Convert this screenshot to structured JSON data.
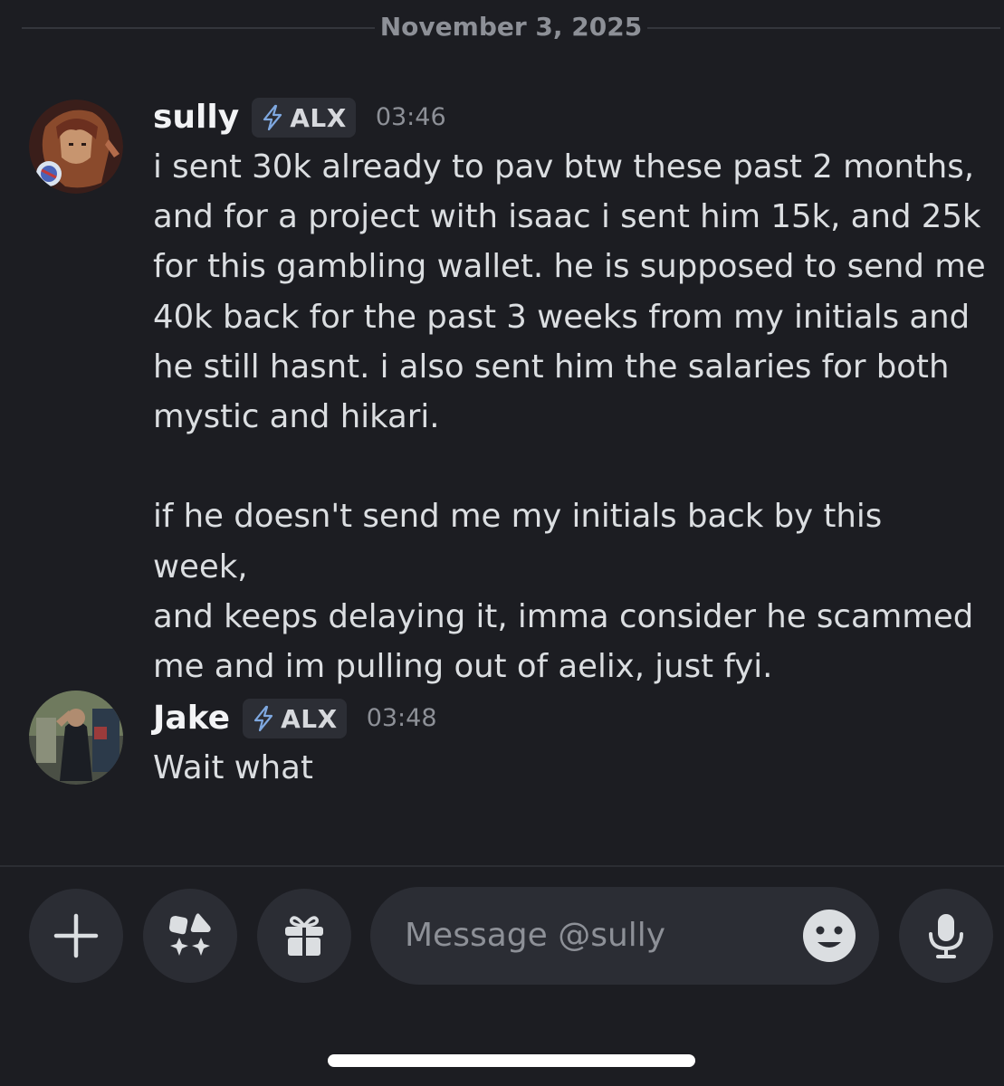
{
  "date_divider": "November 3, 2025",
  "messages": [
    {
      "username": "sully",
      "tag": "ALX",
      "time": "03:46",
      "text": "i sent 30k already to pav btw these past 2 months,\nand for a project with isaac i sent him 15k, and 25k\nfor this gambling wallet. he is supposed to send me\n40k back for the past 3 weeks from my initials and\nhe still hasnt. i also sent him the salaries for both\nmystic and hikari.\n\nif he doesn't send me my initials back by this week,\nand keeps delaying it, imma consider he scammed\nme and im pulling out of aelix, just fyi."
    },
    {
      "username": "Jake",
      "tag": "ALX",
      "time": "03:48",
      "text": "Wait what"
    }
  ],
  "composer": {
    "placeholder": "Message @sully",
    "buttons": [
      "plus-icon",
      "apps-icon",
      "gift-icon",
      "emoji-icon",
      "microphone-icon"
    ]
  },
  "colors": {
    "background": "#1c1d22",
    "button_bg": "#2b2d34",
    "muted_text": "#8d9097",
    "tag_bolt": "#7fa8e0"
  }
}
